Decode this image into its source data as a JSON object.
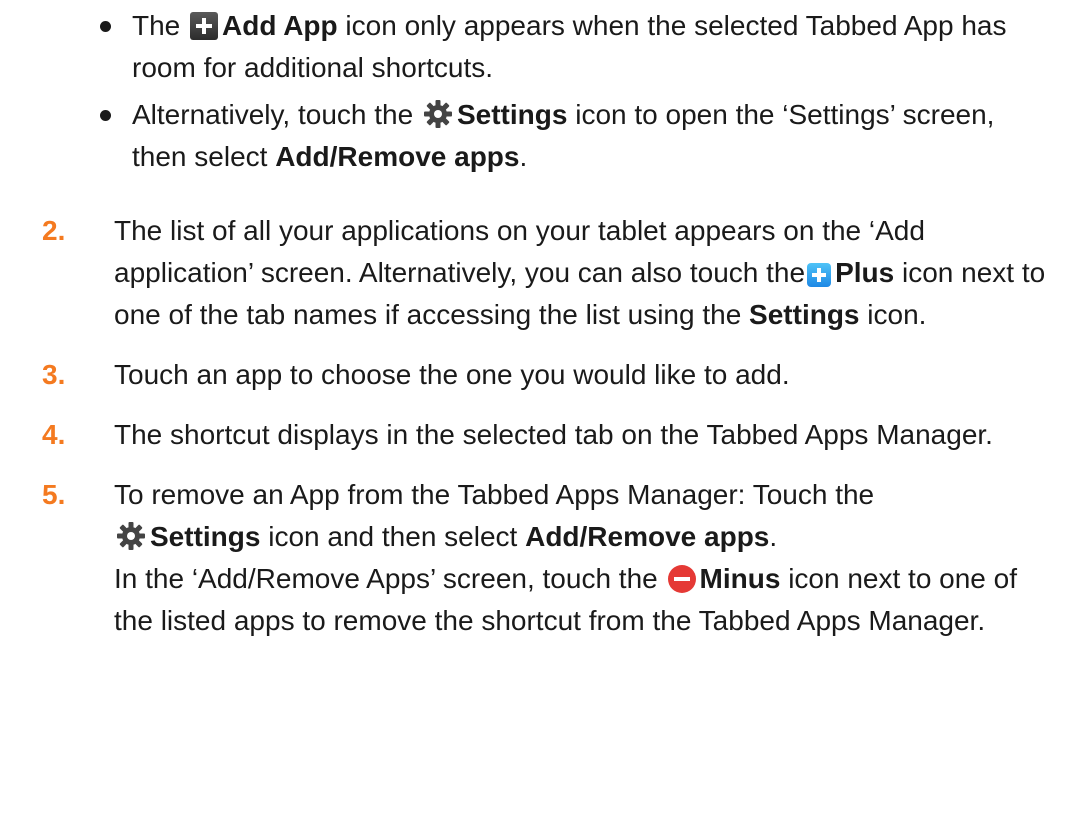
{
  "bullets": [
    {
      "prefix": "The",
      "bold": "Add App",
      "suffix": "icon only appears when the selected Tabbed App has room for additional shortcuts.",
      "icon": "add-square-icon"
    },
    {
      "prefix": "Alternatively, touch the",
      "bold": "Settings",
      "middle": "icon to open the ‘Settings’ screen, then select",
      "bold2": "Add/Remove apps",
      "end": ".",
      "icon": "gear-icon"
    }
  ],
  "steps": [
    {
      "number": "2.",
      "text1": "The list of all your applications on your tablet appears on the ‘Add application’ screen. Alternatively, you can also touch the",
      "bold1": "Plus",
      "text2": "icon next to one of the tab names if accessing the list using the",
      "bold2": "Settings",
      "text3": "icon.",
      "icon": "plus-icon"
    },
    {
      "number": "3.",
      "text": "Touch an app to choose the one you would like to add."
    },
    {
      "number": "4.",
      "text": "The shortcut displays in the selected tab on the Tabbed Apps Manager."
    },
    {
      "number": "5.",
      "text1": "To remove an App from the Tabbed Apps Manager: Touch the",
      "bold1": "Settings",
      "text2": "icon and then select",
      "bold2": "Add/Remove apps",
      "text3": ".",
      "text4": "In the ‘Add/Remove Apps’ screen, touch the",
      "bold3": "Minus",
      "text5": "icon next to one of the listed apps to remove the shortcut from the Tabbed Apps Manager.",
      "icons": [
        "gear-icon",
        "minus-icon"
      ]
    }
  ],
  "colors": {
    "step_number": "#f47a20",
    "text": "#1a1a1a",
    "plus_icon": "#1e88e5",
    "minus_icon": "#e53935"
  }
}
